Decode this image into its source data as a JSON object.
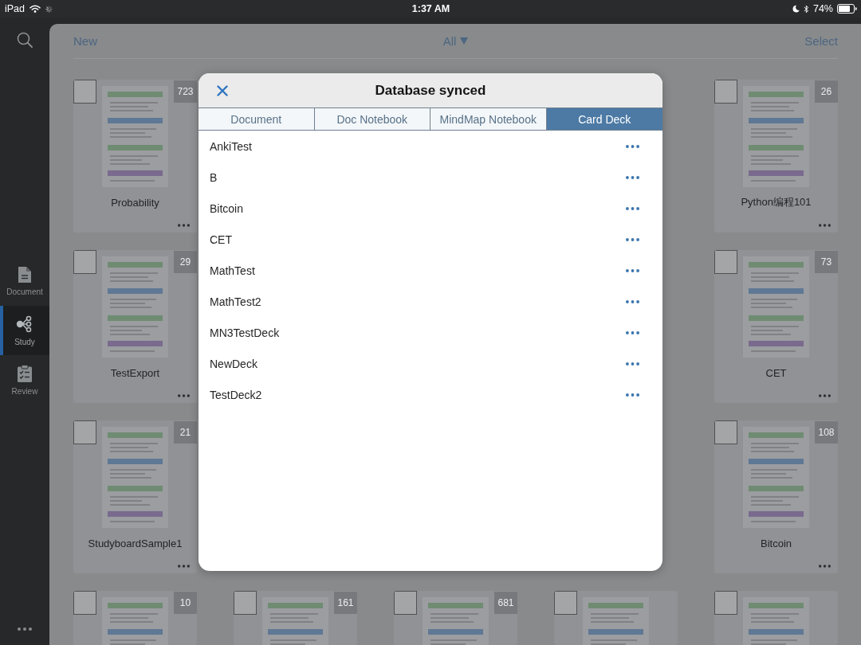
{
  "status_bar": {
    "device": "iPad",
    "time": "1:37 AM",
    "battery": "74%"
  },
  "sidebar": {
    "items": [
      {
        "label": "Document",
        "kind": "document",
        "selected": false
      },
      {
        "label": "Study",
        "kind": "study",
        "selected": true
      },
      {
        "label": "Review",
        "kind": "review",
        "selected": false
      }
    ]
  },
  "toolbar": {
    "new": "New",
    "filter": "All",
    "select": "Select"
  },
  "card_rows": [
    [
      {
        "title": "Probability",
        "count": "723"
      },
      null,
      null,
      null,
      {
        "title": "Python编程101",
        "count": "26"
      }
    ],
    [
      {
        "title": "TestExport",
        "count": "29"
      },
      null,
      null,
      null,
      {
        "title": "CET",
        "count": "73"
      }
    ],
    [
      {
        "title": "StudyboardSample1",
        "count": "21"
      },
      null,
      null,
      null,
      {
        "title": "Bitcoin",
        "count": "108"
      }
    ],
    [
      {
        "count": "10"
      },
      {
        "count": "161"
      },
      {
        "count": "681"
      },
      {},
      {}
    ]
  ],
  "dialog": {
    "title": "Database synced",
    "tabs": [
      {
        "label": "Document",
        "selected": false
      },
      {
        "label": "Doc Notebook",
        "selected": false
      },
      {
        "label": "MindMap Notebook",
        "selected": false
      },
      {
        "label": "Card Deck",
        "selected": true
      }
    ],
    "decks": [
      "AnkiTest",
      "B",
      "Bitcoin",
      "CET",
      "MathTest",
      "MathTest2",
      "MN3TestDeck",
      "NewDeck",
      "TestDeck2"
    ]
  }
}
